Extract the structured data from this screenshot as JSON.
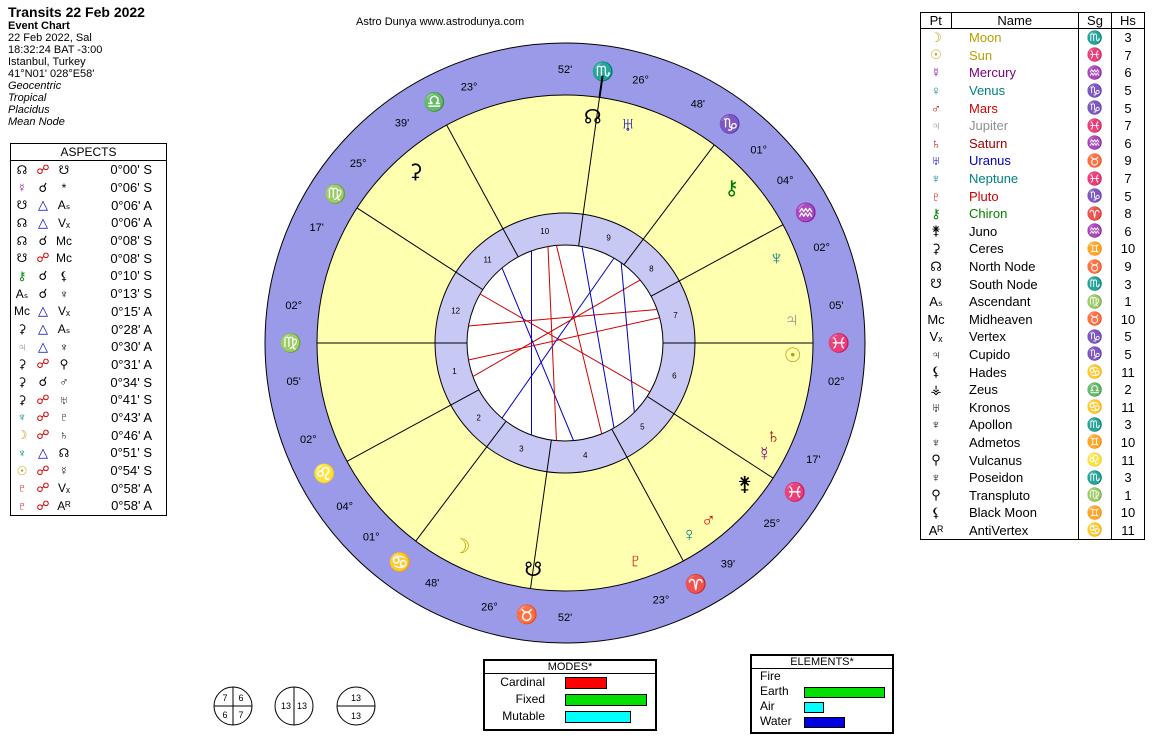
{
  "header": {
    "title": "Transits 22 Feb 2022",
    "chart_type": "Event Chart",
    "date": "22 Feb 2022, Sal",
    "time": "18:32:24  BAT -3:00",
    "place": "Istanbul, Turkey",
    "coords": "41°N01' 028°E58'",
    "zodiac": "Geocentric",
    "zodiac2": "Tropical",
    "houses": "Placidus",
    "node": "Mean Node"
  },
  "site": "Astro Dunya www.astrodunya.com",
  "aspects": {
    "title": "ASPECTS",
    "rows": [
      {
        "p1": "☊",
        "asp": "☍",
        "p2": "☋",
        "orb": "0°00' S",
        "c1": "#000",
        "c2": "#d00000"
      },
      {
        "p1": "☿",
        "asp": "☌",
        "p2": "*",
        "orb": "0°06' S",
        "c1": "#800080",
        "c2": "#000"
      },
      {
        "p1": "☋",
        "asp": "△",
        "p2": "Aₛ",
        "orb": "0°06' A",
        "c1": "#000",
        "c2": "#0000c0"
      },
      {
        "p1": "☊",
        "asp": "△",
        "p2": "Vₓ",
        "orb": "0°06' A",
        "c1": "#000",
        "c2": "#0000c0"
      },
      {
        "p1": "☊",
        "asp": "☌",
        "p2": "Mᴄ",
        "orb": "0°08' S",
        "c1": "#000",
        "c2": "#000"
      },
      {
        "p1": "☋",
        "asp": "☍",
        "p2": "Mᴄ",
        "orb": "0°08' S",
        "c1": "#000",
        "c2": "#d00000"
      },
      {
        "p1": "⚷",
        "asp": "☌",
        "p2": "⚸",
        "orb": "0°10' S",
        "c1": "#008000",
        "c2": "#000"
      },
      {
        "p1": "Aₛ",
        "asp": "☌",
        "p2": "♆",
        "orb": "0°13' S",
        "c1": "#000",
        "c2": "#000"
      },
      {
        "p1": "Mᴄ",
        "asp": "△",
        "p2": "Vₓ",
        "orb": "0°15' A",
        "c1": "#000",
        "c2": "#0000c0"
      },
      {
        "p1": "⚳",
        "asp": "△",
        "p2": "Aₛ",
        "orb": "0°28' A",
        "c1": "#000",
        "c2": "#0000c0"
      },
      {
        "p1": "♃",
        "asp": "△",
        "p2": "♆",
        "orb": "0°30' A",
        "c1": "#808080",
        "c2": "#0000c0"
      },
      {
        "p1": "⚳",
        "asp": "☍",
        "p2": "⚲",
        "orb": "0°31' A",
        "c1": "#000",
        "c2": "#d00000"
      },
      {
        "p1": "⚳",
        "asp": "☌",
        "p2": "♂",
        "orb": "0°34' S",
        "c1": "#000",
        "c2": "#000"
      },
      {
        "p1": "⚳",
        "asp": "☍",
        "p2": "♅",
        "orb": "0°41' S",
        "c1": "#000",
        "c2": "#d00000"
      },
      {
        "p1": "♆",
        "asp": "☍",
        "p2": "♇",
        "orb": "0°43' A",
        "c1": "#008080",
        "c2": "#d00000"
      },
      {
        "p1": "☽",
        "asp": "☍",
        "p2": "♄",
        "orb": "0°46' A",
        "c1": "#b8a000",
        "c2": "#d00000"
      },
      {
        "p1": "♆",
        "asp": "△",
        "p2": "☊",
        "orb": "0°51' S",
        "c1": "#008080",
        "c2": "#0000c0"
      },
      {
        "p1": "☉",
        "asp": "☍",
        "p2": "☿",
        "orb": "0°54' S",
        "c1": "#b8a000",
        "c2": "#d00000"
      },
      {
        "p1": "♇",
        "asp": "☍",
        "p2": "Vₓ",
        "orb": "0°58' A",
        "c1": "#d00000",
        "c2": "#d00000"
      },
      {
        "p1": "♇",
        "asp": "☍",
        "p2": "Aᴿ",
        "orb": "0°58' A",
        "c1": "#d00000",
        "c2": "#d00000"
      }
    ]
  },
  "planets": {
    "headers": {
      "pt": "Pt",
      "name": "Name",
      "sg": "Sg",
      "hs": "Hs"
    },
    "rows": [
      {
        "glyph": "☽",
        "name": "Moon",
        "sign": "♏",
        "house": "3",
        "color": "#b8a000"
      },
      {
        "glyph": "☉",
        "name": "Sun",
        "sign": "♓",
        "house": "7",
        "color": "#b8a000"
      },
      {
        "glyph": "☿",
        "name": "Mercury",
        "sign": "♒",
        "house": "6",
        "color": "#800080"
      },
      {
        "glyph": "♀",
        "name": "Venus",
        "sign": "♑",
        "house": "5",
        "color": "#008080"
      },
      {
        "glyph": "♂",
        "name": "Mars",
        "sign": "♑",
        "house": "5",
        "color": "#d00000"
      },
      {
        "glyph": "♃",
        "name": "Jupiter",
        "sign": "♓",
        "house": "7",
        "color": "#909090"
      },
      {
        "glyph": "♄",
        "name": "Saturn",
        "sign": "♒",
        "house": "6",
        "color": "#a00000"
      },
      {
        "glyph": "♅",
        "name": "Uranus",
        "sign": "♉",
        "house": "9",
        "color": "#0000c0"
      },
      {
        "glyph": "♆",
        "name": "Neptune",
        "sign": "♓",
        "house": "7",
        "color": "#008080"
      },
      {
        "glyph": "♇",
        "name": "Pluto",
        "sign": "♑",
        "house": "5",
        "color": "#d00000"
      },
      {
        "glyph": "⚷",
        "name": "Chiron",
        "sign": "♈",
        "house": "8",
        "color": "#008000"
      },
      {
        "glyph": "⚵",
        "name": "Juno",
        "sign": "♒",
        "house": "6",
        "color": "#000"
      },
      {
        "glyph": "⚳",
        "name": "Ceres",
        "sign": "♊",
        "house": "10",
        "color": "#000"
      },
      {
        "glyph": "☊",
        "name": "North Node",
        "sign": "♉",
        "house": "9",
        "color": "#000"
      },
      {
        "glyph": "☋",
        "name": "South Node",
        "sign": "♏",
        "house": "3",
        "color": "#000"
      },
      {
        "glyph": "Aₛ",
        "name": "Ascendant",
        "sign": "♍",
        "house": "1",
        "color": "#000"
      },
      {
        "glyph": "Mᴄ",
        "name": "Midheaven",
        "sign": "♉",
        "house": "10",
        "color": "#000"
      },
      {
        "glyph": "Vₓ",
        "name": "Vertex",
        "sign": "♑",
        "house": "5",
        "color": "#000"
      },
      {
        "glyph": "♃",
        "name": "Cupido",
        "sign": "♑",
        "house": "5",
        "color": "#000"
      },
      {
        "glyph": "⚸",
        "name": "Hades",
        "sign": "♋",
        "house": "11",
        "color": "#000"
      },
      {
        "glyph": "⚶",
        "name": "Zeus",
        "sign": "♎",
        "house": "2",
        "color": "#000"
      },
      {
        "glyph": "♅",
        "name": "Kronos",
        "sign": "♋",
        "house": "11",
        "color": "#000"
      },
      {
        "glyph": "♆",
        "name": "Apollon",
        "sign": "♏",
        "house": "3",
        "color": "#000"
      },
      {
        "glyph": "♆",
        "name": "Admetos",
        "sign": "♊",
        "house": "10",
        "color": "#000"
      },
      {
        "glyph": "⚲",
        "name": "Vulcanus",
        "sign": "♌",
        "house": "11",
        "color": "#000"
      },
      {
        "glyph": "♆",
        "name": "Poseidon",
        "sign": "♏",
        "house": "3",
        "color": "#000"
      },
      {
        "glyph": "⚲",
        "name": "Transpluto",
        "sign": "♍",
        "house": "1",
        "color": "#000"
      },
      {
        "glyph": "⚸",
        "name": "Black Moon",
        "sign": "♊",
        "house": "10",
        "color": "#000"
      },
      {
        "glyph": "Aᴿ",
        "name": "AntiVertex",
        "sign": "♋",
        "house": "11",
        "color": "#000"
      }
    ]
  },
  "modes": {
    "title": "MODES*",
    "items": [
      {
        "label": "Cardinal",
        "value": 0.2,
        "color": "#ff0000"
      },
      {
        "label": "Fixed",
        "value": 0.4,
        "color": "#00e000"
      },
      {
        "label": "Mutable",
        "value": 0.32,
        "color": "#00ffff"
      }
    ]
  },
  "elements": {
    "title": "ELEMENTS*",
    "items": [
      {
        "label": "Fire",
        "value": 0,
        "color": "#ff0000"
      },
      {
        "label": "Earth",
        "value": 0.45,
        "color": "#00e000"
      },
      {
        "label": "Air",
        "value": 0.1,
        "color": "#00ffff"
      },
      {
        "label": "Water",
        "value": 0.22,
        "color": "#0000e0"
      }
    ]
  },
  "hemis": [
    {
      "tl": "7",
      "tr": "6",
      "bl": "6",
      "br": "7"
    },
    {
      "l": "13",
      "r": "13"
    },
    {
      "t": "13",
      "b": "13"
    }
  ],
  "wheel": {
    "colors": {
      "outer": "#9a9ae8",
      "inner": "#ffffb0",
      "ring": "#c8c8f5"
    },
    "cusp_labels": [
      {
        "deg": "26°",
        "min": "52'",
        "sign": "♉",
        "color": "#008000"
      },
      {
        "deg": "23°",
        "min": "39'",
        "sign": "♈",
        "color": "#d00000"
      },
      {
        "deg": "25°",
        "min": "17'",
        "sign": "♓",
        "color": "#0000c0"
      },
      {
        "deg": "02°",
        "min": "05'",
        "sign": "♓",
        "color": "#0000c0"
      },
      {
        "deg": "02°",
        "min": "04°",
        "sign": "♒",
        "color": "#0000c0"
      },
      {
        "deg": "01°",
        "min": "48'",
        "sign": "♑",
        "color": "#008000"
      },
      {
        "deg": "26°",
        "min": "52'",
        "sign": "♏",
        "color": "#0000c0"
      },
      {
        "deg": "23°",
        "min": "39'",
        "sign": "♎",
        "color": "#0000c0"
      },
      {
        "deg": "25°",
        "min": "17'",
        "sign": "♍",
        "color": "#008000"
      },
      {
        "deg": "02°",
        "min": "05'",
        "sign": "♍",
        "color": "#008000"
      },
      {
        "deg": "02°",
        "min": "04°",
        "sign": "♌",
        "color": "#d00000"
      },
      {
        "deg": "01°",
        "min": "48'",
        "sign": "♋",
        "color": "#0000c0"
      }
    ],
    "house_numbers": [
      "1",
      "2",
      "3",
      "4",
      "5",
      "6",
      "7",
      "8",
      "9",
      "10",
      "11",
      "12"
    ]
  }
}
